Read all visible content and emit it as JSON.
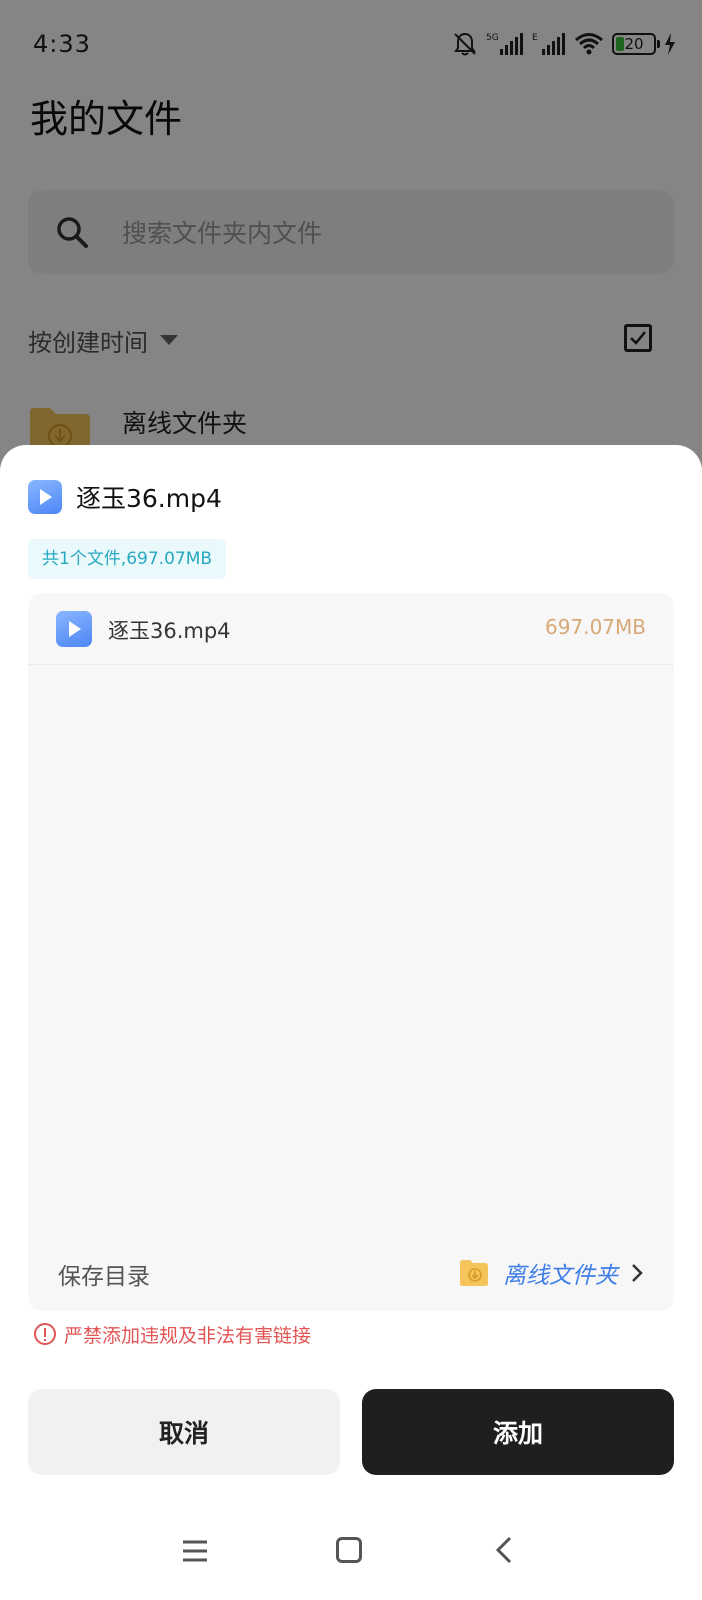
{
  "status_bar": {
    "time": "4:33",
    "battery_level": "20",
    "network_labels": [
      "5G",
      "E"
    ]
  },
  "background_page": {
    "title": "我的文件",
    "search": {
      "placeholder": "搜索文件夹内文件"
    },
    "sort_label": "按创建时间",
    "folders": [
      {
        "name": "离线文件夹",
        "icon": "download-folder-icon"
      }
    ]
  },
  "sheet": {
    "title": "逐玉36.mp4",
    "summary": "共1个文件,697.07MB",
    "files": [
      {
        "name": "逐玉36.mp4",
        "size": "697.07MB",
        "icon": "video-file-icon"
      }
    ],
    "save_dir": {
      "label": "保存目录",
      "folder_name": "离线文件夹"
    },
    "warning": "严禁添加违规及非法有害链接",
    "cancel_label": "取消",
    "add_label": "添加"
  },
  "colors": {
    "accent_blue": "#3f7ee8",
    "file_size": "#d8a878",
    "badge_text": "#28a8c0",
    "warning": "#e25555",
    "primary_button": "#1f1f1f"
  }
}
